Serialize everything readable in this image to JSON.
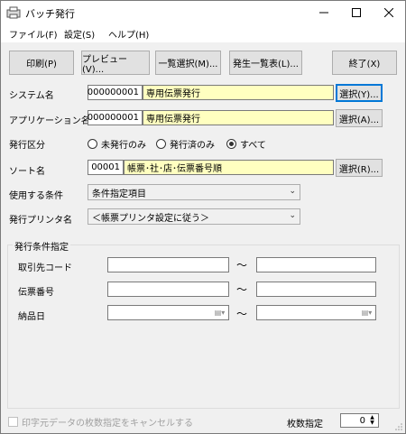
{
  "window": {
    "title": "バッチ発行"
  },
  "menu": [
    "ファイル(F)",
    "設定(S)",
    "ヘルプ(H)"
  ],
  "toolbar": {
    "print": "印刷(P)",
    "preview": "プレビュー(V)...",
    "list_select": "一覧選択(M)...",
    "issue_list": "発生一覧表(L)...",
    "exit": "終了(X)"
  },
  "system": {
    "label": "システム名",
    "code": "000000001",
    "name": "専用伝票発行",
    "button": "選択(Y)..."
  },
  "application": {
    "label": "アプリケーション名",
    "code": "000000001",
    "name": "専用伝票発行",
    "button": "選択(A)..."
  },
  "issue_type": {
    "label": "発行区分",
    "options": [
      "未発行のみ",
      "発行済のみ",
      "すべて"
    ],
    "selected": "すべて"
  },
  "sort": {
    "label": "ソート名",
    "code": "00001",
    "name": "帳票･社･店･伝票番号順",
    "button": "選択(R)..."
  },
  "condition": {
    "label": "使用する条件",
    "value": "条件指定項目"
  },
  "printer": {
    "label": "発行プリンタ名",
    "value": "＜帳票プリンタ設定に従う＞"
  },
  "criteria": {
    "title": "発行条件指定",
    "fields": [
      {
        "label": "取引先コード",
        "from": "",
        "to": ""
      },
      {
        "label": "伝票番号",
        "from": "",
        "to": ""
      },
      {
        "label": "納品日",
        "from": "",
        "to": ""
      }
    ],
    "tilde": "～"
  },
  "footer": {
    "cancel_check": "印字元データの枚数指定をキャンセルする",
    "copies_label": "枚数指定",
    "copies_value": "0"
  }
}
